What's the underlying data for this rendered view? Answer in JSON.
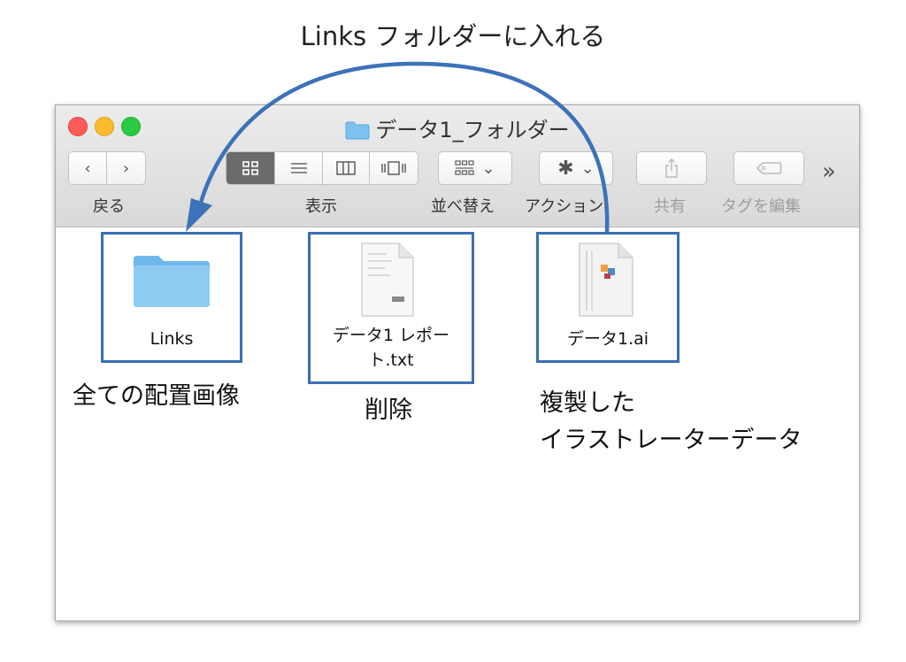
{
  "annotation_top": "Links フォルダーに入れる",
  "window": {
    "title": "データ1_フォルダー",
    "colors": {
      "close": "#fc5b57",
      "minimize": "#fdbb2e",
      "maximize": "#2acb42",
      "highlight_border": "#3c6eb4",
      "arrow": "#3c72b8"
    }
  },
  "toolbar": {
    "back_label": "戻る",
    "view_label": "表示",
    "arrange_label": "並べ替え",
    "action_label": "アクション",
    "share_label": "共有",
    "tags_label": "タグを編集",
    "overflow_label": "»",
    "back_icon": "‹",
    "forward_icon": "›",
    "arrange_chevron": "⌄",
    "action_chevron": "⌄"
  },
  "files": [
    {
      "name": "Links",
      "type": "folder-icon"
    },
    {
      "name_line1": "データ1 レポー",
      "name_line2": "ト.txt",
      "type": "text-file-icon"
    },
    {
      "name": "データ1.ai",
      "type": "illustrator-file-icon"
    }
  ],
  "captions": {
    "links": "全ての配置画像",
    "report": "削除",
    "ai_line1": "複製した",
    "ai_line2": "イラストレーターデータ"
  }
}
